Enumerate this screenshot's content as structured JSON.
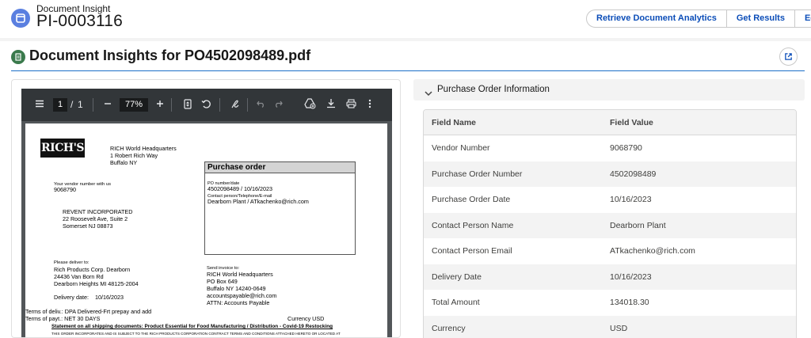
{
  "header": {
    "object_label": "Document Insight",
    "record_name": "PI-0003116",
    "buttons": [
      "Retrieve Document Analytics",
      "Get Results",
      "Edit"
    ]
  },
  "card": {
    "title": "Document Insights for PO4502098489.pdf",
    "icon": "document-icon",
    "action_icon": "external-link-icon"
  },
  "pdf_viewer": {
    "current_page": "1",
    "page_separator": "/",
    "total_pages": "1",
    "zoom": "77%",
    "toolbar_icons": [
      "menu-icon",
      "zoom-out-icon",
      "zoom-in-icon",
      "fit-page-icon",
      "rotate-icon",
      "annotate-icon",
      "undo-icon",
      "redo-icon",
      "add-to-drive-icon",
      "download-icon",
      "print-icon",
      "more-options-icon"
    ],
    "document": {
      "logo_text": "RICH'S",
      "hq_lines": [
        "RICH World Headquarters",
        "1 Robert Rich Way",
        "Buffalo NY"
      ],
      "vendor_label": "Your vendor number with us",
      "vendor_number": "9068790",
      "vendor_address": [
        "REVENT INCORPORATED",
        "22 Roosevelt Ave, Suite 2",
        "Somerset NJ  08873"
      ],
      "po_box_title": "Purchase order",
      "po_number_label": "PO number/date",
      "po_number_value": "4502098489 / 10/16/2023",
      "contact_label": "Contact person/Telephone/E-mail",
      "contact_value": "Dearborn Plant / ATkachenko@rich.com",
      "deliver_label": "Please deliver to:",
      "deliver_lines": [
        "Rich Products Corp. Dearborn",
        "24436 Van Born Rd",
        "Dearborn Heights MI  48125-2004"
      ],
      "invoice_label": "Send invoice to:",
      "invoice_lines": [
        "RICH World Headquarters",
        "PO Box 649",
        "Buffalo NY  14240-0649",
        "accountspayable@rich.com",
        "ATTN: Accounts Payable"
      ],
      "delivery_date_label": "Delivery date:",
      "delivery_date_value": "10/16/2023",
      "terms_delivery": "Terms of deliv.: DPA Delivered-Frt prepay and add",
      "terms_payment": "Terms of payt.: NET 30 DAYS",
      "currency": "Currency USD",
      "statement_line": "Statement on all shipping documents: Product Essential for Food Manufacturing / Distribution - Covid-19 Restocking",
      "fine_print": "THIS ORDER INCORPORATES AND IS SUBJECT TO THE RICH PRODUCTS CORPORATION CONTRACT TERMS AND CONDITIONS ATTACHED HERETO OR LOCATED AT"
    }
  },
  "po_info": {
    "section_title": "Purchase Order Information",
    "columns": [
      "Field Name",
      "Field Value"
    ],
    "rows": [
      [
        "Vendor Number",
        "9068790"
      ],
      [
        "Purchase Order Number",
        "4502098489"
      ],
      [
        "Purchase Order Date",
        "10/16/2023"
      ],
      [
        "Contact Person Name",
        "Dearborn Plant"
      ],
      [
        "Contact Person Email",
        "ATkachenko@rich.com"
      ],
      [
        "Delivery Date",
        "10/16/2023"
      ],
      [
        "Total Amount",
        "134018.30"
      ],
      [
        "Currency",
        "USD"
      ]
    ]
  },
  "colors": {
    "accent": "#0b4db8",
    "app_icon": "#5a7fe0",
    "doc_icon": "#3a7a4c",
    "divider": "#1b6fc8",
    "viewer_bg": "#525659",
    "toolbar_bg": "#323639"
  }
}
